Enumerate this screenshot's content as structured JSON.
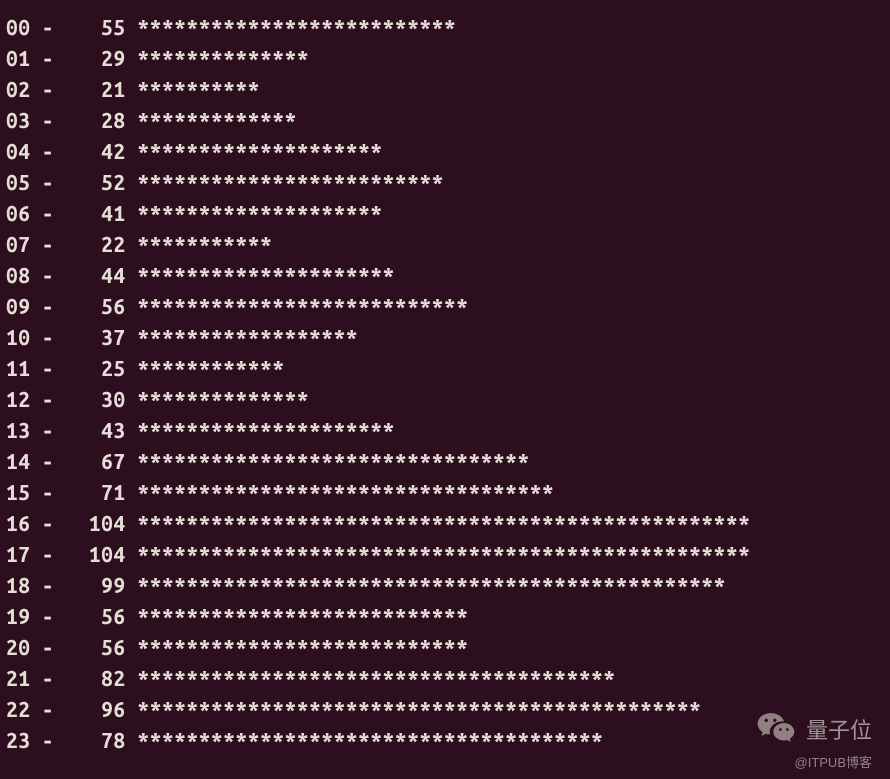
{
  "chart_data": {
    "type": "bar",
    "title": "",
    "xlabel": "",
    "ylabel": "",
    "max_stars": 50,
    "rows": [
      {
        "index": "00",
        "value": 55
      },
      {
        "index": "01",
        "value": 29
      },
      {
        "index": "02",
        "value": 21
      },
      {
        "index": "03",
        "value": 28
      },
      {
        "index": "04",
        "value": 42
      },
      {
        "index": "05",
        "value": 52
      },
      {
        "index": "06",
        "value": 41
      },
      {
        "index": "07",
        "value": 22
      },
      {
        "index": "08",
        "value": 44
      },
      {
        "index": "09",
        "value": 56
      },
      {
        "index": "10",
        "value": 37
      },
      {
        "index": "11",
        "value": 25
      },
      {
        "index": "12",
        "value": 30
      },
      {
        "index": "13",
        "value": 43
      },
      {
        "index": "14",
        "value": 67
      },
      {
        "index": "15",
        "value": 71
      },
      {
        "index": "16",
        "value": 104
      },
      {
        "index": "17",
        "value": 104
      },
      {
        "index": "18",
        "value": 99
      },
      {
        "index": "19",
        "value": 56
      },
      {
        "index": "20",
        "value": 56
      },
      {
        "index": "21",
        "value": 82
      },
      {
        "index": "22",
        "value": 96
      },
      {
        "index": "23",
        "value": 78
      }
    ]
  },
  "separator": " -  ",
  "star_char": "*",
  "watermark": {
    "text": "量子位",
    "sub": "@ITPUB博客"
  }
}
